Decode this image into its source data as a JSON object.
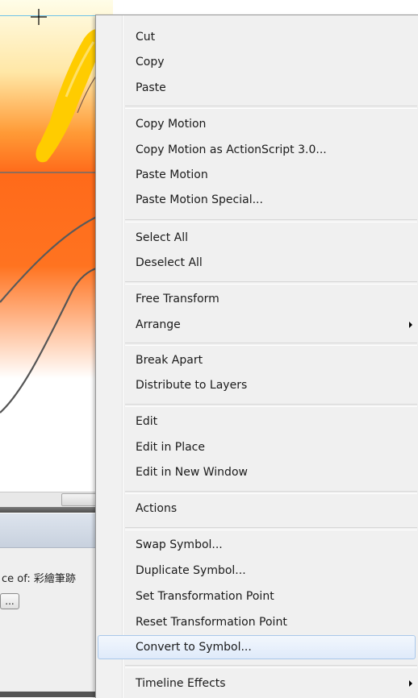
{
  "menu": {
    "items": [
      {
        "label": "Cut"
      },
      {
        "label": "Copy"
      },
      {
        "label": "Paste"
      },
      {
        "label": "Copy Motion"
      },
      {
        "label": "Copy Motion as ActionScript 3.0..."
      },
      {
        "label": "Paste Motion"
      },
      {
        "label": "Paste Motion Special..."
      },
      {
        "label": "Select All"
      },
      {
        "label": "Deselect All"
      },
      {
        "label": "Free Transform"
      },
      {
        "label": "Arrange",
        "submenu": true
      },
      {
        "label": "Break Apart"
      },
      {
        "label": "Distribute to Layers"
      },
      {
        "label": "Edit"
      },
      {
        "label": "Edit in Place"
      },
      {
        "label": "Edit in New Window"
      },
      {
        "label": "Actions"
      },
      {
        "label": "Swap Symbol..."
      },
      {
        "label": "Duplicate Symbol..."
      },
      {
        "label": "Set Transformation Point"
      },
      {
        "label": "Reset Transformation Point"
      },
      {
        "label": "Convert to Symbol...",
        "highlighted": true
      },
      {
        "label": "Timeline Effects",
        "submenu": true
      }
    ]
  },
  "properties": {
    "instance_label": "ce of:  彩繪筆跡",
    "swap_button": "..."
  },
  "icons": {
    "submenu_arrow": "triangle-right-icon",
    "crosshair": "crosshair-cursor-icon"
  },
  "colors": {
    "highlight_border": "#a9c8ea",
    "menu_background": "#f0f0f0",
    "stage_orange": "#ff6a1a"
  }
}
